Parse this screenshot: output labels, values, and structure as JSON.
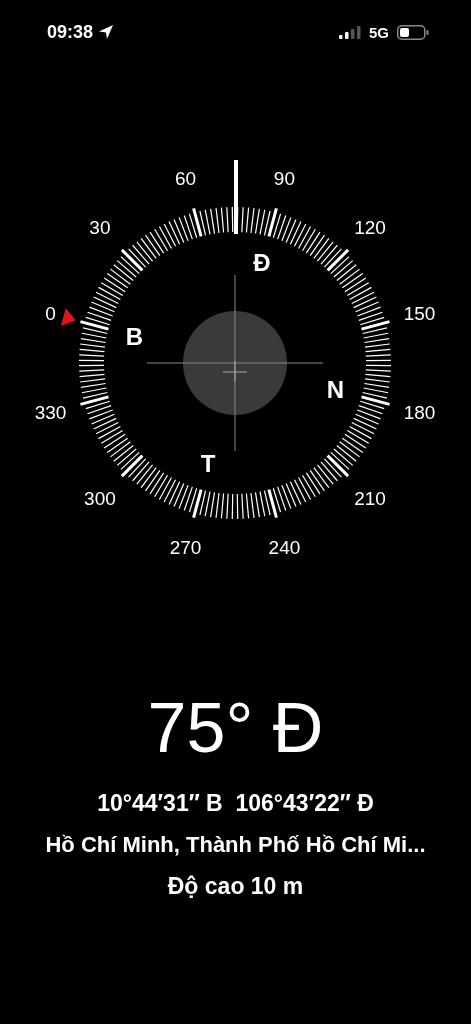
{
  "status_bar": {
    "time": "09:38",
    "network": "5G"
  },
  "compass": {
    "degree_labels": [
      "0",
      "30",
      "60",
      "90",
      "120",
      "150",
      "180",
      "210",
      "240",
      "270",
      "300",
      "330"
    ],
    "cardinal_labels": [
      "B",
      "Đ",
      "N",
      "T"
    ]
  },
  "heading": "75° Đ",
  "coordinates": "10°44′31″ B  106°43′22″ Đ",
  "place": "Hồ Chí Minh, Thành Phố Hồ Chí Mi...",
  "altitude": "Độ cao 10 m"
}
